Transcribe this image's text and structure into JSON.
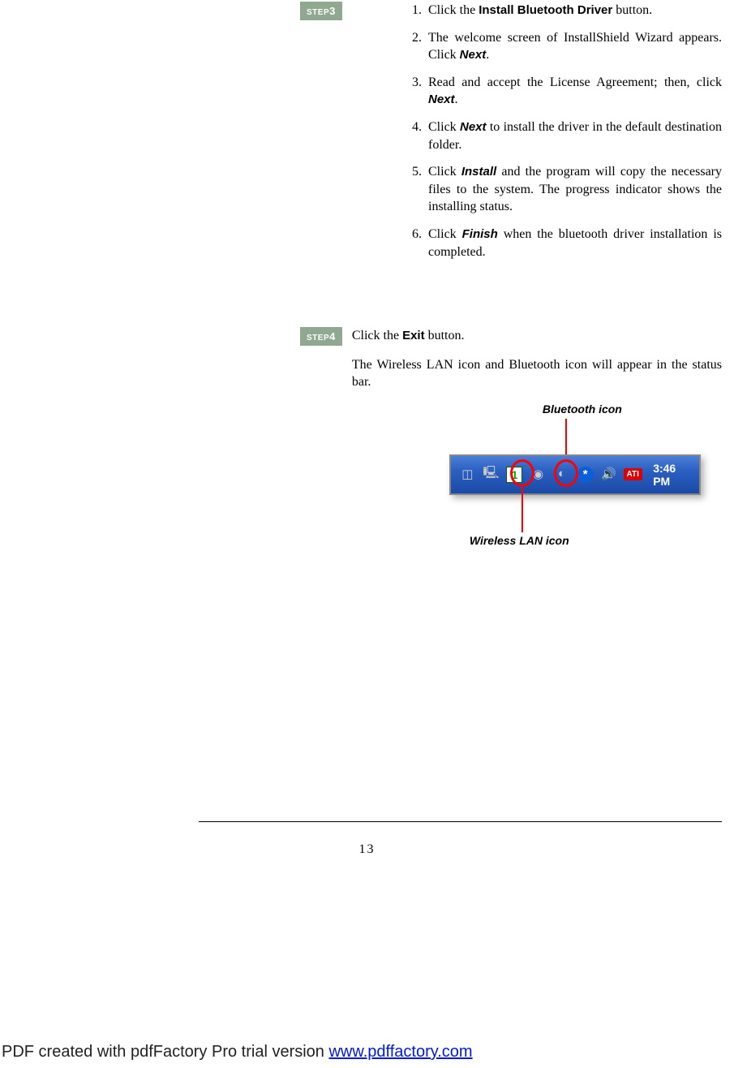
{
  "step3": {
    "badge_prefix": "STEP",
    "badge_num": "3",
    "items": [
      {
        "pre": "Click the ",
        "bold": "Install Bluetooth Driver",
        "post": " button."
      },
      {
        "pre": "The welcome screen of InstallShield Wizard appears.  Click ",
        "boldit": "Next",
        "post": "."
      },
      {
        "pre": "Read and accept the License Agreement; then, click ",
        "boldit": "Next",
        "post": "."
      },
      {
        "pre": "Click ",
        "boldit": "Next",
        "post": " to install the driver in the default destination folder."
      },
      {
        "pre": "Click ",
        "boldit": "Install",
        "post": " and the program will copy the necessary files to the system.  The progress indicator shows the installing status."
      },
      {
        "pre": "Click ",
        "boldit": "Finish",
        "post": " when the bluetooth driver installation is completed."
      }
    ]
  },
  "step4": {
    "badge_prefix": "STEP",
    "badge_num": "4",
    "line1_pre": "Click the ",
    "line1_bold": "Exit",
    "line1_post": " button.",
    "line2": "The Wireless LAN icon and Bluetooth icon will appear in the status bar."
  },
  "diagram": {
    "bt_label": "Bluetooth icon",
    "wlan_label": "Wireless LAN icon",
    "wlan_badge": "1",
    "bt_symbol": "*",
    "ati_text": "ATI",
    "clock": "3:46 PM"
  },
  "page_number": "13",
  "footer": {
    "text": "PDF created with pdfFactory Pro trial version ",
    "link": "www.pdffactory.com"
  }
}
